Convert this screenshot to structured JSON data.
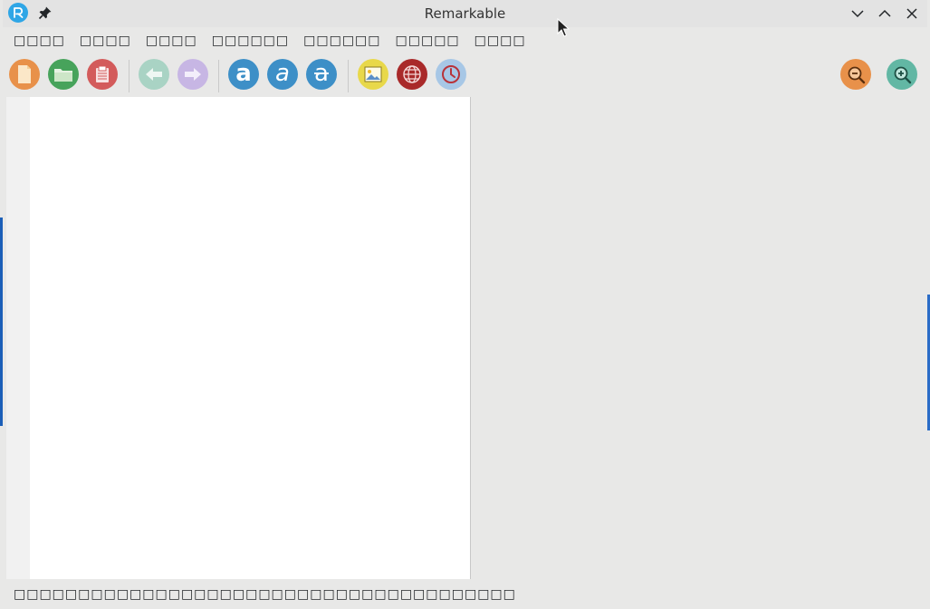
{
  "window": {
    "title": "Remarkable"
  },
  "menubar": {
    "items": [
      "□□□□",
      "□□□□",
      "□□□□",
      "□□□□□□",
      "□□□□□□",
      "□□□□□",
      "□□□□"
    ]
  },
  "toolbar": {
    "buttons": [
      {
        "name": "new-document-icon",
        "color": "#e8914a"
      },
      {
        "name": "open-folder-icon",
        "color": "#47a35b"
      },
      {
        "name": "save-icon",
        "color": "#d35b5b"
      },
      {
        "name": "undo-arrow-icon",
        "color": "#a9d3c4"
      },
      {
        "name": "redo-arrow-icon",
        "color": "#c7b6e4"
      },
      {
        "name": "bold-icon",
        "glyph": "a",
        "color": "#3d8fc7"
      },
      {
        "name": "italic-icon",
        "glyph": "a",
        "color": "#3d8fc7"
      },
      {
        "name": "strikethrough-icon",
        "glyph": "a",
        "color": "#3d8fc7"
      },
      {
        "name": "image-icon",
        "color": "#e8d84a"
      },
      {
        "name": "link-globe-icon",
        "color": "#a92a2a"
      },
      {
        "name": "timestamp-clock-icon",
        "color": "#a7c7e6"
      },
      {
        "name": "zoom-out-icon",
        "color": "#e8914a"
      },
      {
        "name": "zoom-in-icon",
        "color": "#62b7a4"
      }
    ]
  },
  "statusbar": {
    "text": "□□□□□□□□□□□□□□□□□□□□□□□□□□□□□□□□□□□□□□□"
  },
  "colors": {
    "app_icon": "#2fa6e6",
    "window_bg": "#e8e8e7",
    "editor_bg": "#ffffff",
    "gutter_bg": "#f1f1f1"
  }
}
